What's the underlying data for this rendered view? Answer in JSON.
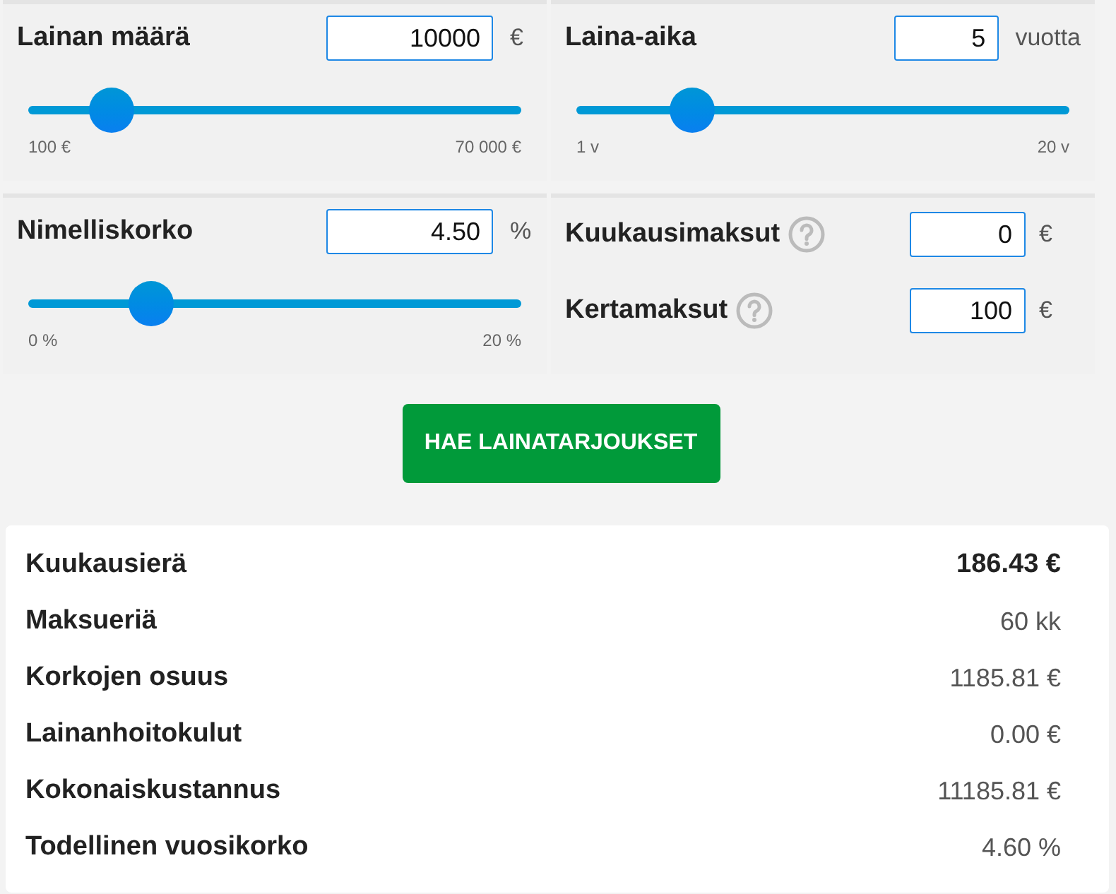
{
  "sliders": [
    {
      "label": "Lainan määrä",
      "value": "10000",
      "unit": "€",
      "level": 0.17,
      "min_label": "100 €",
      "max_label": "70 000 €"
    },
    {
      "label": "Laina-aika",
      "value": "5",
      "unit": "vuotta",
      "level": 0.236,
      "min_label": "1 v",
      "max_label": "20 v"
    },
    {
      "label": "Nimelliskorko",
      "value": "4.50",
      "unit": "%",
      "level": 0.25,
      "min_label": "0 %",
      "max_label": "20 %"
    }
  ],
  "fees": [
    {
      "label": "Kuukausimaksut",
      "value": "0",
      "unit": "€"
    },
    {
      "label": "Kertamaksut",
      "value": "100",
      "unit": "€"
    }
  ],
  "submit_button": "HAE LAINATARJOUKSET",
  "results": [
    {
      "label": "Kuukausierä",
      "value": "186.43 €",
      "emphasized": true
    },
    {
      "label": "Maksueriä",
      "value": "60 kk",
      "emphasized": false
    },
    {
      "label": "Korkojen osuus",
      "value": "1185.81 €",
      "emphasized": false
    },
    {
      "label": "Lainanhoitokulut",
      "value": "0.00 €",
      "emphasized": false
    },
    {
      "label": "Kokonaiskustannus",
      "value": "11185.81 €",
      "emphasized": false
    },
    {
      "label": "Todellinen vuosikorko",
      "value": "4.60 %",
      "emphasized": false
    }
  ]
}
